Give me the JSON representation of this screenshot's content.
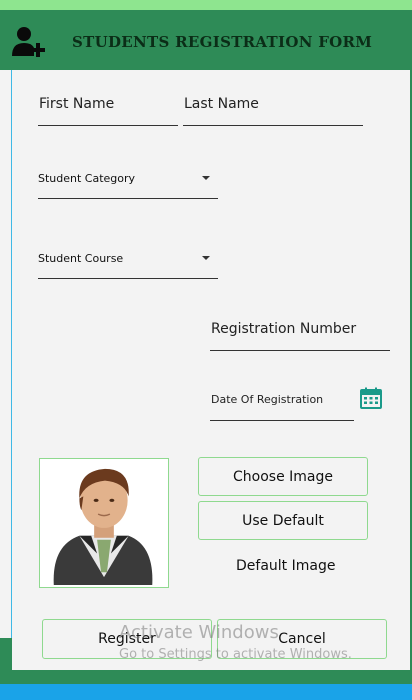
{
  "header": {
    "title": "STUDENTS REGISTRATION FORM",
    "icon": "add-user-icon"
  },
  "form": {
    "first_name_placeholder": "First Name",
    "last_name_placeholder": "Last Name",
    "student_category_label": "Student Category",
    "student_course_label": "Student Course",
    "registration_number_placeholder": "Registration Number",
    "date_of_registration_label": "Date Of Registration"
  },
  "image_section": {
    "choose_image_label": "Choose Image",
    "use_default_label": "Use Default",
    "default_image_caption": "Default Image",
    "avatar_icon": "businessman-avatar"
  },
  "actions": {
    "register_label": "Register",
    "cancel_label": "Cancel"
  },
  "watermark": {
    "title": "Activate Windows",
    "subtitle": "Go to Settings to activate Windows."
  },
  "colors": {
    "header_bg": "#2e8b57",
    "top_strip": "#8ee58f",
    "bottom_strip": "#1aa3e8",
    "button_border": "#8fd98f",
    "accent_teal": "#1a9a8a"
  }
}
